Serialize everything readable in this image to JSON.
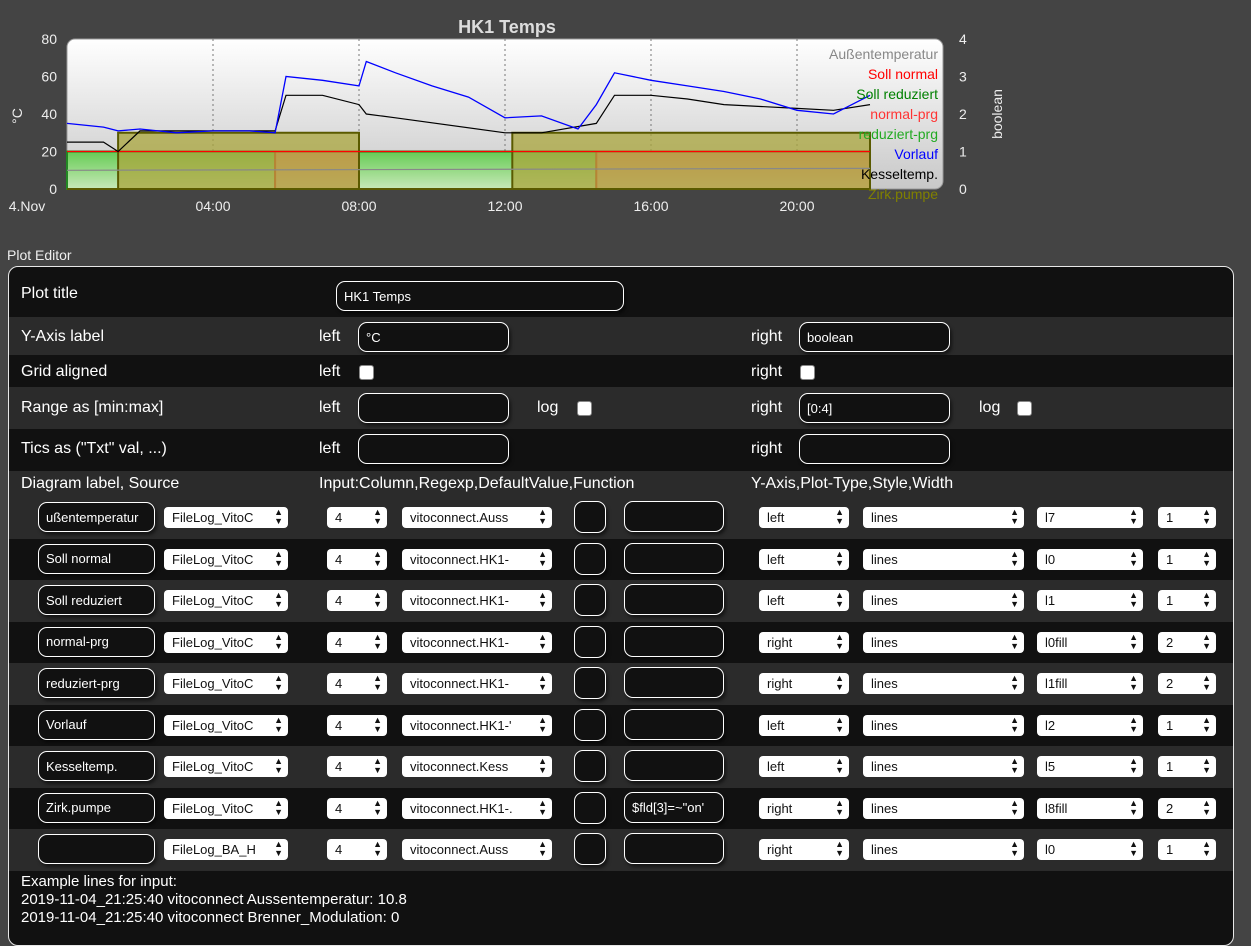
{
  "chart": {
    "title": "HK1 Temps",
    "y_left_label": "°C",
    "y_right_label": "boolean",
    "y_left_ticks": [
      "80",
      "60",
      "40",
      "20",
      "0"
    ],
    "y_right_ticks": [
      "4",
      "3",
      "2",
      "1",
      "0"
    ],
    "x_ticks": [
      "4.Nov",
      "04:00",
      "08:00",
      "12:00",
      "16:00",
      "20:00"
    ],
    "legend": [
      {
        "name": "Außentemperatur",
        "color": "#888888"
      },
      {
        "name": "Soll normal",
        "color": "#ff0000"
      },
      {
        "name": "Soll reduziert",
        "color": "#008000"
      },
      {
        "name": "normal-prg",
        "color": "#ff3333"
      },
      {
        "name": "reduziert-prg",
        "color": "#22aa22"
      },
      {
        "name": "Vorlauf",
        "color": "#0000ff"
      },
      {
        "name": "Kesseltemp.",
        "color": "#000000"
      },
      {
        "name": "Zirk.pumpe",
        "color": "#808000"
      }
    ]
  },
  "chart_data": {
    "type": "line",
    "title": "HK1 Temps",
    "ylabel": "°C",
    "y2label": "boolean",
    "ylim": [
      0,
      80
    ],
    "y2lim": [
      0,
      4
    ],
    "x_ticks": [
      "4.Nov",
      "04:00",
      "08:00",
      "12:00",
      "16:00",
      "20:00"
    ],
    "xlim_hours": [
      0,
      24
    ],
    "grid": "vertical dotted",
    "legend_position": "right",
    "series": [
      {
        "name": "Soll normal",
        "axis": "left",
        "style": "step",
        "color": "#ff0000",
        "x": [
          0,
          1.4,
          5.7,
          6.4,
          6.4,
          8,
          10,
          10,
          12.2,
          14.5,
          14.5,
          18,
          19,
          20.5,
          22
        ],
        "y": [
          20,
          20,
          20,
          20,
          20,
          20,
          20,
          20,
          20,
          20,
          20,
          20,
          20,
          20,
          20
        ]
      },
      {
        "name": "Soll reduziert",
        "axis": "left",
        "style": "step",
        "color": "#008000",
        "x": [
          0,
          22
        ],
        "y": [
          20,
          20
        ]
      },
      {
        "name": "normal-prg",
        "axis": "right",
        "style": "fill",
        "color": "#ff3333",
        "x": [
          0,
          5.7,
          5.7,
          8,
          8,
          14.5,
          14.5,
          22,
          22
        ],
        "y": [
          0,
          0,
          1,
          1,
          0,
          0,
          1,
          1,
          0
        ]
      },
      {
        "name": "reduziert-prg",
        "axis": "right",
        "style": "fill",
        "color": "#22aa22",
        "x": [
          0,
          5.7,
          5.7,
          8,
          8,
          14.5,
          14.5,
          22
        ],
        "y": [
          1,
          1,
          0,
          0,
          1,
          1,
          0,
          0
        ]
      },
      {
        "name": "Vorlauf",
        "axis": "left",
        "style": "line",
        "color": "#0000ff",
        "x": [
          0,
          1,
          1.4,
          2,
          3,
          4,
          5,
          5.7,
          6,
          7,
          8,
          8.2,
          9,
          10,
          11,
          12,
          13,
          14,
          14.5,
          15,
          16,
          17,
          18,
          19,
          20,
          21,
          22
        ],
        "y": [
          35,
          33,
          31,
          32,
          30,
          31,
          31,
          30,
          60,
          58,
          55,
          68,
          62,
          55,
          49,
          38,
          39,
          32,
          45,
          62,
          58,
          55,
          52,
          48,
          42,
          40,
          50
        ]
      },
      {
        "name": "Kesseltemp.",
        "axis": "left",
        "style": "line",
        "color": "#000000",
        "x": [
          0,
          1,
          1.4,
          2,
          4,
          5.7,
          6,
          7,
          8,
          8.2,
          9,
          12,
          12.2,
          13,
          14.5,
          15,
          16,
          17,
          18,
          19,
          20,
          21,
          22
        ],
        "y": [
          25,
          25,
          20,
          31,
          31,
          31,
          50,
          50,
          45,
          40,
          38,
          30,
          30,
          30,
          35,
          50,
          50,
          48,
          45,
          44,
          43,
          42,
          45
        ]
      },
      {
        "name": "Zirk.pumpe",
        "axis": "right",
        "style": "fill",
        "color": "#808000",
        "x": [
          0,
          1.4,
          1.4,
          5.7,
          5.7,
          8,
          8,
          12.2,
          12.2,
          14.5,
          14.5,
          22,
          22
        ],
        "y": [
          0,
          0,
          1.5,
          1.5,
          1.5,
          1.5,
          0,
          0,
          1.5,
          1.5,
          1.5,
          1.5,
          0
        ]
      },
      {
        "name": "Außentemperatur",
        "axis": "left",
        "style": "line",
        "color": "#888888",
        "x": [
          0,
          22
        ],
        "y": [
          10,
          11
        ]
      }
    ]
  },
  "editor": {
    "section_title": "Plot Editor",
    "plot_title_label": "Plot title",
    "plot_title_value": "HK1 Temps",
    "yaxis_label": "Y-Axis label",
    "yaxis_left_value": "°C",
    "yaxis_right_value": "boolean",
    "grid_label": "Grid aligned",
    "range_label": "Range as [min:max]",
    "range_left_value": "",
    "range_right_value": "[0:4]",
    "tics_label": "Tics as (\"Txt\" val, ...)",
    "tics_left_value": "",
    "tics_right_value": "",
    "left": "left",
    "right": "right",
    "log": "log",
    "col_header_1": "Diagram label, Source",
    "col_header_2": "Input:Column,Regexp,DefaultValue,Function",
    "col_header_3": "Y-Axis,Plot-Type,Style,Width",
    "rows": [
      {
        "label": "ußentemperatur",
        "source": "FileLog_VitoC",
        "column": "4",
        "regexp": "vitoconnect.Auss",
        "default": "",
        "function": "",
        "axis": "left",
        "type": "lines",
        "style": "l7",
        "width": "1"
      },
      {
        "label": "Soll normal",
        "source": "FileLog_VitoC",
        "column": "4",
        "regexp": "vitoconnect.HK1-",
        "default": "",
        "function": "",
        "axis": "left",
        "type": "lines",
        "style": "l0",
        "width": "1"
      },
      {
        "label": "Soll reduziert",
        "source": "FileLog_VitoC",
        "column": "4",
        "regexp": "vitoconnect.HK1-",
        "default": "",
        "function": "",
        "axis": "left",
        "type": "lines",
        "style": "l1",
        "width": "1"
      },
      {
        "label": "normal-prg",
        "source": "FileLog_VitoC",
        "column": "4",
        "regexp": "vitoconnect.HK1-",
        "default": "",
        "function": "",
        "axis": "right",
        "type": "lines",
        "style": "l0fill",
        "width": "2"
      },
      {
        "label": "reduziert-prg",
        "source": "FileLog_VitoC",
        "column": "4",
        "regexp": "vitoconnect.HK1-",
        "default": "",
        "function": "",
        "axis": "right",
        "type": "lines",
        "style": "l1fill",
        "width": "2"
      },
      {
        "label": "Vorlauf",
        "source": "FileLog_VitoC",
        "column": "4",
        "regexp": "vitoconnect.HK1-'",
        "default": "",
        "function": "",
        "axis": "left",
        "type": "lines",
        "style": "l2",
        "width": "1"
      },
      {
        "label": "Kesseltemp.",
        "source": "FileLog_VitoC",
        "column": "4",
        "regexp": "vitoconnect.Kess",
        "default": "",
        "function": "",
        "axis": "left",
        "type": "lines",
        "style": "l5",
        "width": "1"
      },
      {
        "label": "Zirk.pumpe",
        "source": "FileLog_VitoC",
        "column": "4",
        "regexp": "vitoconnect.HK1-.",
        "default": "",
        "function": "$fld[3]=~\"on'",
        "axis": "right",
        "type": "lines",
        "style": "l8fill",
        "width": "2"
      },
      {
        "label": "",
        "source": "FileLog_BA_H",
        "column": "4",
        "regexp": "vitoconnect.Auss",
        "default": "",
        "function": "",
        "axis": "right",
        "type": "lines",
        "style": "l0",
        "width": "1"
      }
    ],
    "example_title": "Example lines for input:",
    "example_lines": [
      "2019-11-04_21:25:40 vitoconnect Aussentemperatur: 10.8",
      "2019-11-04_21:25:40 vitoconnect Brenner_Modulation: 0"
    ]
  }
}
